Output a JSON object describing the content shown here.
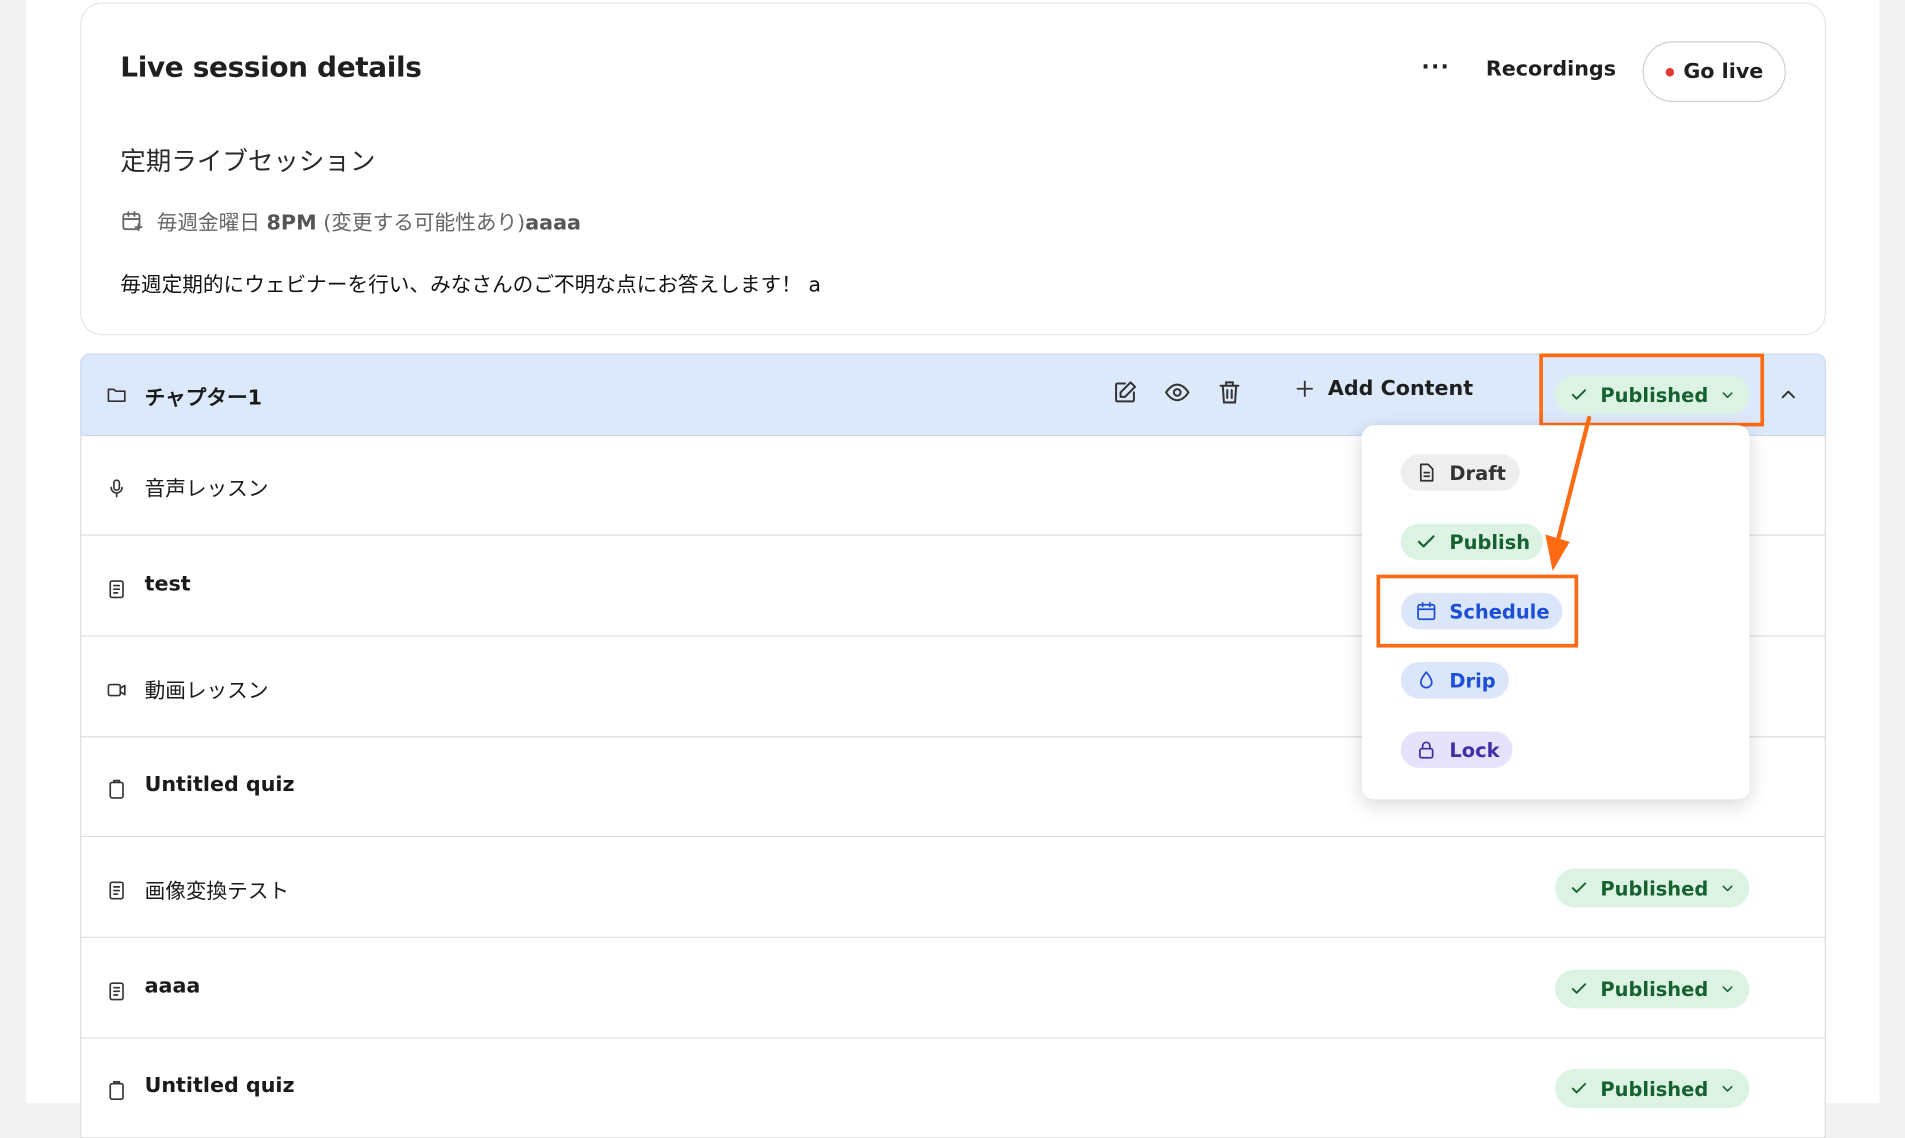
{
  "header": {
    "title": "Live session details",
    "more_label": "···",
    "recordings_label": "Recordings",
    "golive_label": "Go live"
  },
  "session": {
    "name": "定期ライブセッション",
    "schedule_prefix": "毎週金曜日 ",
    "schedule_time": "8PM",
    "schedule_suffix": " (変更する可能性あり)",
    "schedule_tail": "aaaa",
    "description": "毎週定期的にウェビナーを行い、みなさんのご不明な点にお答えします！ a"
  },
  "chapter": {
    "title": "チャプター1",
    "add_content_label": "Add Content",
    "status_label": "Published"
  },
  "lessons": [
    {
      "label": "音声レッスン",
      "type": "audio",
      "status": ""
    },
    {
      "label": "test",
      "type": "text",
      "status": ""
    },
    {
      "label": "動画レッスン",
      "type": "video",
      "status": ""
    },
    {
      "label": "Untitled quiz",
      "type": "quiz",
      "status": ""
    },
    {
      "label": "画像変換テスト",
      "type": "text",
      "status": "Published"
    },
    {
      "label": "aaaa",
      "type": "text",
      "status": "Published"
    },
    {
      "label": "Untitled quiz",
      "type": "quiz",
      "status": "Published"
    }
  ],
  "status_menu": {
    "items": [
      {
        "label": "Draft",
        "icon": "document-icon",
        "bg": "#eeeeee",
        "fg": "#333333"
      },
      {
        "label": "Publish",
        "icon": "check-icon",
        "bg": "#dcf3e3",
        "fg": "#15612f"
      },
      {
        "label": "Schedule",
        "icon": "calendar-icon",
        "bg": "#dbe6fb",
        "fg": "#1d4ed8"
      },
      {
        "label": "Drip",
        "icon": "drop-icon",
        "bg": "#dbe6fb",
        "fg": "#1d4ed8"
      },
      {
        "label": "Lock",
        "icon": "lock-icon",
        "bg": "#e6e2fb",
        "fg": "#3f2ea6"
      }
    ]
  },
  "colors": {
    "accent_highlight": "#ff6a13",
    "chapter_bg": "#dbe9fb",
    "published_bg": "#dcf3e3",
    "published_fg": "#15612f"
  }
}
